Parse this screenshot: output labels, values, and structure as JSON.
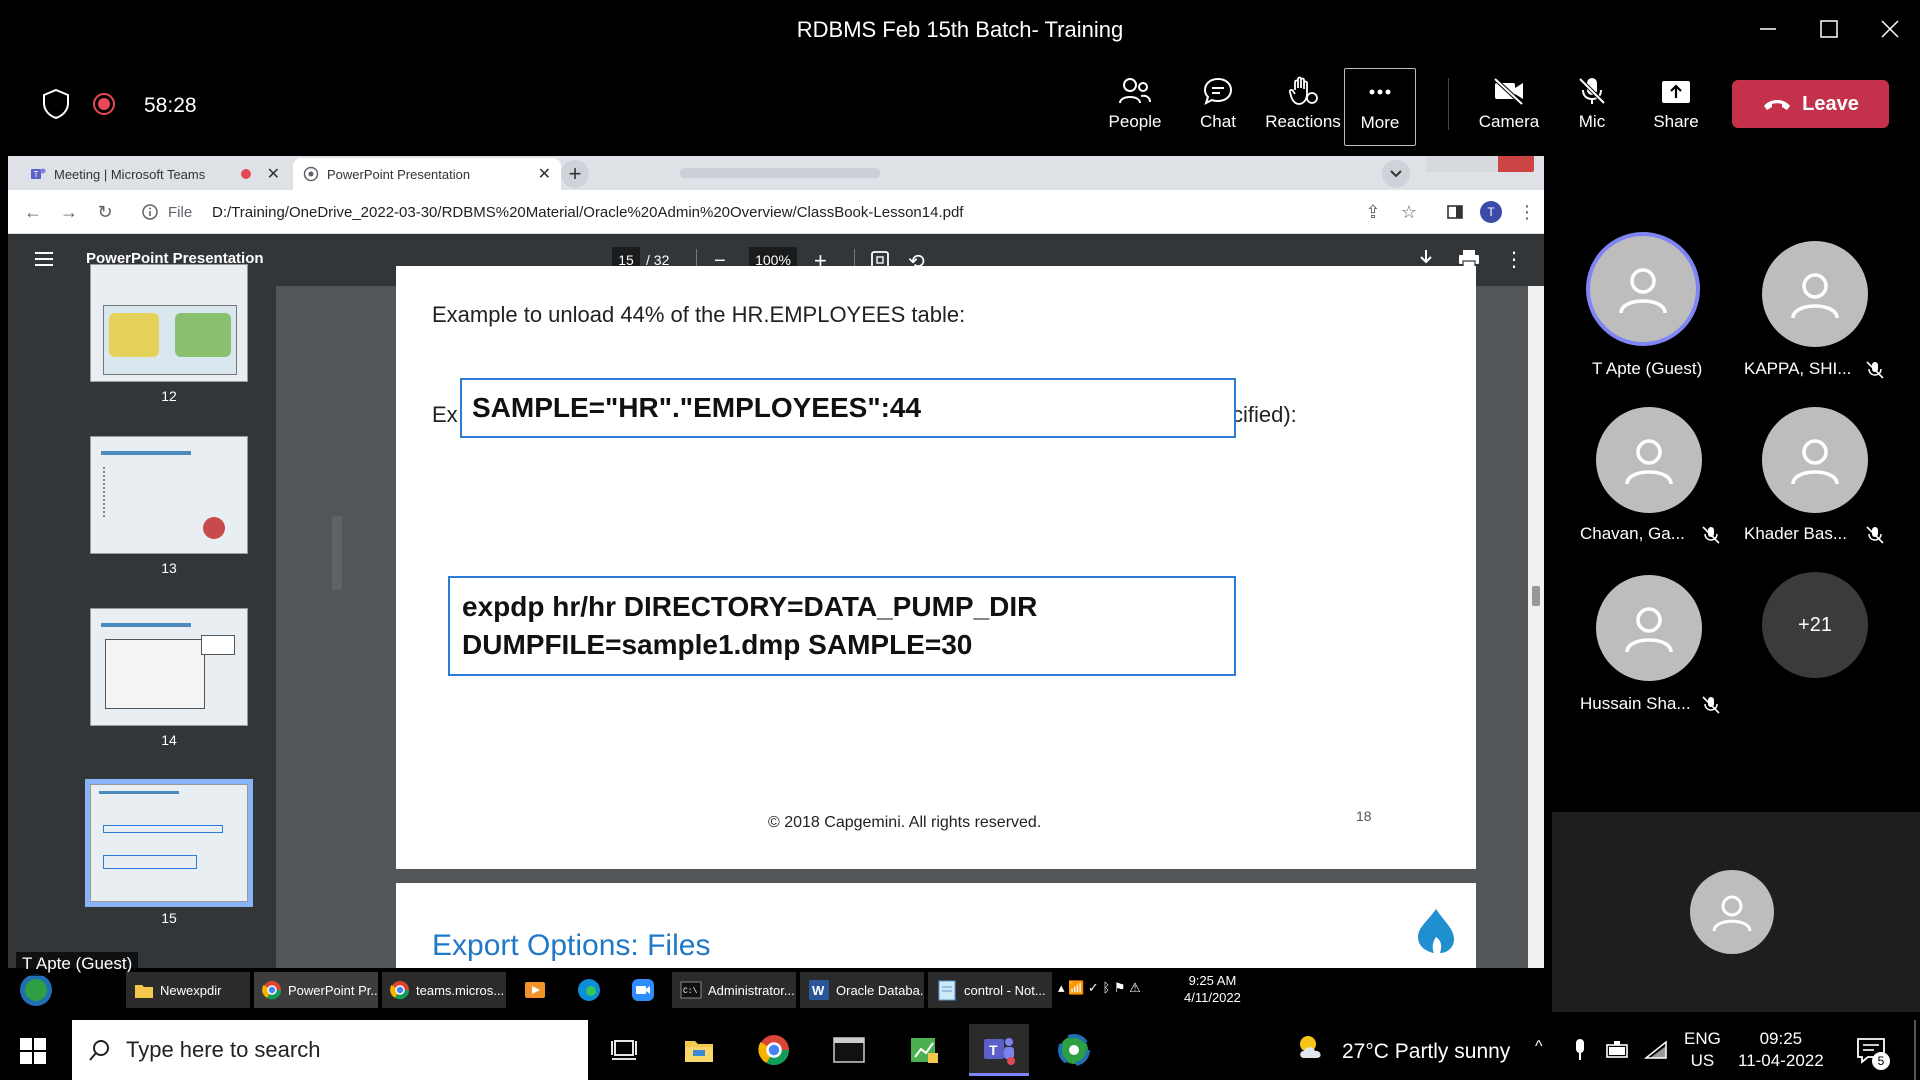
{
  "window": {
    "title": "RDBMS Feb 15th Batch- Training"
  },
  "meeting": {
    "elapsed": "58:28",
    "buttons": {
      "people": "People",
      "chat": "Chat",
      "reactions": "Reactions",
      "more": "More",
      "camera": "Camera",
      "mic": "Mic",
      "share": "Share",
      "leave": "Leave"
    }
  },
  "browser": {
    "tabs": [
      {
        "label": "Meeting | Microsoft Teams"
      },
      {
        "label": "PowerPoint Presentation"
      }
    ],
    "file_label": "File",
    "url": "D:/Training/OneDrive_2022-03-30/RDBMS%20Material/Oracle%20Admin%20Overview/ClassBook-Lesson14.pdf",
    "profile_initial": "T"
  },
  "pdf": {
    "title": "PowerPoint Presentation",
    "page": "15",
    "page_total": "/ 32",
    "zoom": "100%",
    "thumbnails": [
      {
        "label": "12"
      },
      {
        "label": "13"
      },
      {
        "label": "14"
      },
      {
        "label": "15"
      }
    ],
    "slide": {
      "heading": "Example to unload 44% of the HR.EMPLOYEES table:",
      "line2_prefix": "Ex",
      "line2_suffix": "cified):",
      "code1": "SAMPLE=\"HR\".\"EMPLOYEES\":44",
      "code2_line1": "expdp hr/hr DIRECTORY=DATA_PUMP_DIR",
      "code2_line2": "DUMPFILE=sample1.dmp SAMPLE=30",
      "footer": "© 2018 Capgemini. All rights reserved.",
      "page_number": "18"
    },
    "next_slide_title": "Export Options: Files"
  },
  "participants": [
    {
      "name": "T Apte (Guest)",
      "muted": false,
      "speaking": true
    },
    {
      "name": "KAPPA, SHI...",
      "muted": true
    },
    {
      "name": "Chavan, Ga...",
      "muted": true
    },
    {
      "name": "Khader Bas...",
      "muted": true
    },
    {
      "name": "Hussain Sha...",
      "muted": true
    }
  ],
  "overflow_count": "+21",
  "presenter_label": "T Apte (Guest)",
  "inner_taskbar": {
    "items": [
      "Newexpdir",
      "PowerPoint Pr...",
      "teams.micros...",
      "Administrator...",
      "Oracle Databa...",
      "control - Not..."
    ],
    "time": "9:25 AM",
    "date": "4/11/2022"
  },
  "taskbar": {
    "search_placeholder": "Type here to search",
    "weather": "27°C  Partly sunny",
    "lang_top": "ENG",
    "lang_bottom": "US",
    "time": "09:25",
    "date": "11-04-2022",
    "notifications": "5"
  },
  "colors": {
    "leave": "#c4314b",
    "speaking_ring": "#7f85f5",
    "pdf_toolbar": "#323639",
    "highlight_box": "#2b7bd8"
  }
}
